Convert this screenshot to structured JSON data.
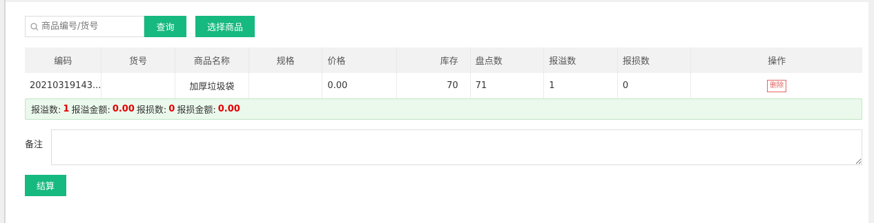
{
  "search": {
    "placeholder": "商品编号/货号",
    "value": ""
  },
  "buttons": {
    "query": "查询",
    "select_goods": "选择商品",
    "settle": "结算"
  },
  "table": {
    "headers": [
      "编码",
      "货号",
      "商品名称",
      "规格",
      "价格",
      "库存",
      "盘点数",
      "报溢数",
      "报损数",
      "操作"
    ],
    "rows": [
      {
        "code": "20210319143...",
        "sku": "",
        "name": "加厚垃圾袋",
        "spec": "",
        "price": "0.00",
        "stock": "70",
        "count": "71",
        "overflow": "1",
        "loss": "0",
        "action": "删除"
      }
    ]
  },
  "summary": {
    "overflow_count_label": "报溢数:",
    "overflow_count": "1",
    "overflow_amount_label": "报溢金额:",
    "overflow_amount": "0.00",
    "loss_count_label": "报损数:",
    "loss_count": "0",
    "loss_amount_label": "报损金额:",
    "loss_amount": "0.00"
  },
  "remark": {
    "label": "备注",
    "value": ""
  },
  "colors": {
    "primary": "#16b97f",
    "danger": "#e20000",
    "summary_bg": "#ebf8ec"
  }
}
